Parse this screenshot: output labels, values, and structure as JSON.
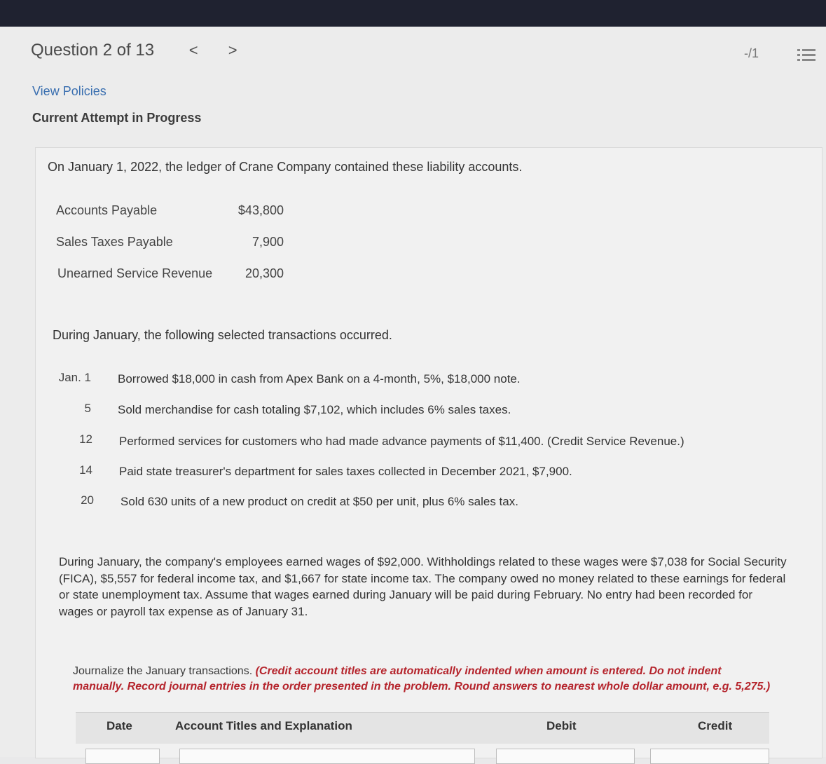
{
  "nav": {
    "question_label": "Question 2 of 13",
    "prev_glyph": "<",
    "next_glyph": ">",
    "score": "-/1"
  },
  "links": {
    "view_policies": "View Policies"
  },
  "status": {
    "attempt": "Current Attempt in Progress"
  },
  "problem": {
    "intro": "On January 1, 2022, the ledger of Crane Company contained these liability accounts.",
    "accounts": [
      {
        "name": "Accounts Payable",
        "amount": "$43,800"
      },
      {
        "name": "Sales Taxes Payable",
        "amount": "7,900"
      },
      {
        "name": "Unearned Service Revenue",
        "amount": "20,300"
      }
    ],
    "during_intro": "During January, the following selected transactions occurred.",
    "transactions": [
      {
        "date": "Jan. 1",
        "text": "Borrowed $18,000 in cash from Apex Bank on a 4-month, 5%, $18,000 note."
      },
      {
        "date": "5",
        "text": "Sold merchandise for cash totaling $7,102, which includes 6% sales taxes."
      },
      {
        "date": "12",
        "text": "Performed services for customers who had made advance payments of $11,400. (Credit Service Revenue.)"
      },
      {
        "date": "14",
        "text": "Paid state treasurer's department for sales taxes collected in December 2021, $7,900."
      },
      {
        "date": "20",
        "text": "Sold 630 units of a new product on credit at $50 per unit, plus 6% sales tax."
      }
    ],
    "wages_paragraph": "During January, the company's employees earned wages of $92,000. Withholdings related to these wages were $7,038 for Social Security (FICA), $5,557 for federal income tax, and $1,667 for state income tax. The company owed no money related to these earnings for federal or state unemployment tax. Assume that wages earned during January will be paid during February. No entry had been recorded for wages or payroll tax expense as of January 31."
  },
  "instructions": {
    "lead": "Journalize the January transactions. ",
    "emphasis": "(Credit account titles are automatically indented when amount is entered. Do not indent manually. Record journal entries in the order presented in the problem. Round answers to nearest whole dollar amount, e.g. 5,275.)"
  },
  "table": {
    "headers": {
      "date": "Date",
      "account": "Account Titles and Explanation",
      "debit": "Debit",
      "credit": "Credit"
    }
  },
  "colors": {
    "link": "#3a6fb0",
    "emphasis": "#b5242c",
    "topbar": "#1f2230"
  },
  "icons": {
    "list": "list-icon"
  }
}
